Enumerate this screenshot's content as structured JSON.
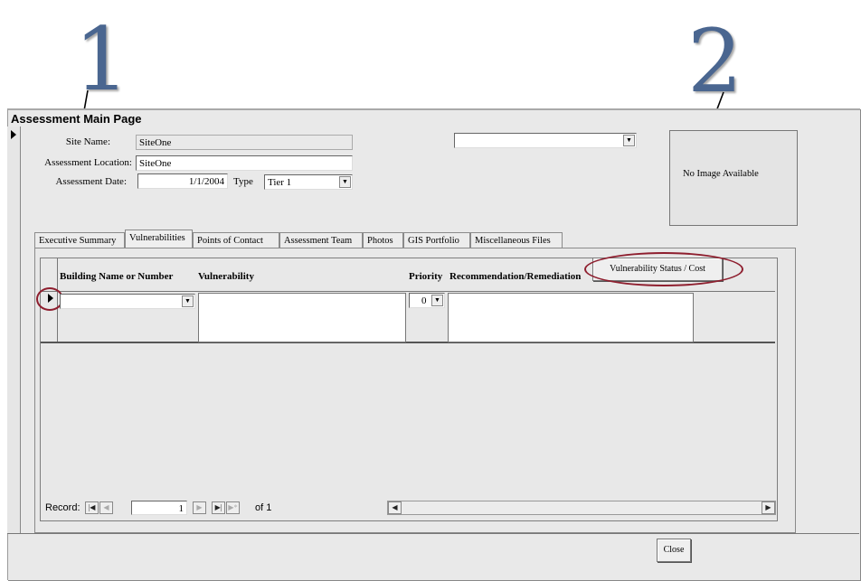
{
  "annotations": {
    "callout_1": "1",
    "callout_2": "2"
  },
  "window": {
    "title": "Assessment Main Page"
  },
  "form": {
    "site_name_label": "Site Name:",
    "site_name_value": "SiteOne",
    "location_label": "Assessment Location:",
    "location_value": "SiteOne",
    "date_label": "Assessment Date:",
    "date_value": "1/1/2004",
    "type_label": "Type",
    "type_value": "Tier 1",
    "top_dropdown_value": "",
    "image_text": "No Image Available"
  },
  "tabs": [
    {
      "label": "Executive Summary",
      "active": false
    },
    {
      "label": "Vulnerabilities",
      "active": true
    },
    {
      "label": "Points of Contact",
      "active": false
    },
    {
      "label": "Assessment Team",
      "active": false
    },
    {
      "label": "Photos",
      "active": false
    },
    {
      "label": "GIS Portfolio",
      "active": false
    },
    {
      "label": "Miscellaneous Files",
      "active": false
    }
  ],
  "grid": {
    "columns": {
      "building": "Building Name or Number",
      "vulnerability": "Vulnerability",
      "priority": "Priority",
      "recommendation": "Recommendation/Remediation",
      "status_cost_button": "Vulnerability Status / Cost"
    },
    "row": {
      "building": "",
      "vulnerability": "",
      "priority": "0",
      "recommendation": ""
    }
  },
  "record_nav": {
    "label": "Record:",
    "current": "1",
    "of_label": "of 1"
  },
  "buttons": {
    "close": "Close"
  },
  "colors": {
    "annotation_oval": "#8e1e2e",
    "callout_number": "#4a6690"
  }
}
